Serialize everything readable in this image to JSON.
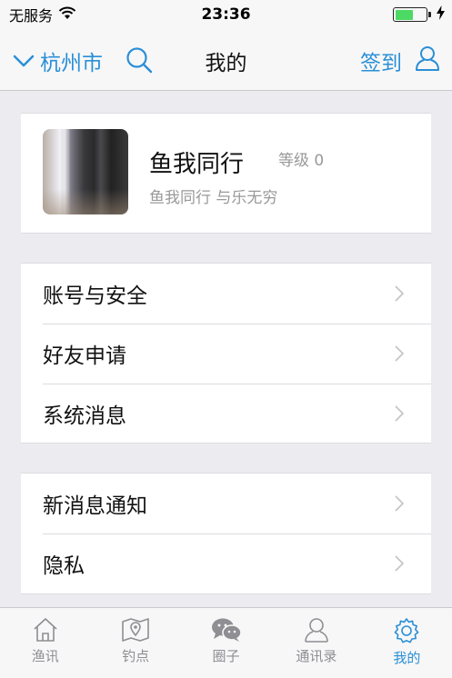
{
  "status_bar": {
    "carrier": "无服务",
    "time": "23:36",
    "battery_level": 0.6
  },
  "nav": {
    "city": "杭州市",
    "title": "我的",
    "checkin": "签到"
  },
  "profile": {
    "name": "鱼我同行",
    "level": "等级 0",
    "signature": "鱼我同行 与乐无穷"
  },
  "menu_group_1": [
    {
      "label": "账号与安全"
    },
    {
      "label": "好友申请"
    },
    {
      "label": "系统消息"
    }
  ],
  "menu_group_2": [
    {
      "label": "新消息通知"
    },
    {
      "label": "隐私"
    }
  ],
  "tabs": [
    {
      "label": "渔讯",
      "icon": "house-icon"
    },
    {
      "label": "钓点",
      "icon": "map-pin-icon"
    },
    {
      "label": "圈子",
      "icon": "chat-bubbles-icon"
    },
    {
      "label": "通讯录",
      "icon": "contact-icon"
    },
    {
      "label": "我的",
      "icon": "gear-icon",
      "active": true
    }
  ],
  "colors": {
    "accent": "#2a8fd6",
    "background": "#ececf0",
    "battery": "#4cd964"
  }
}
